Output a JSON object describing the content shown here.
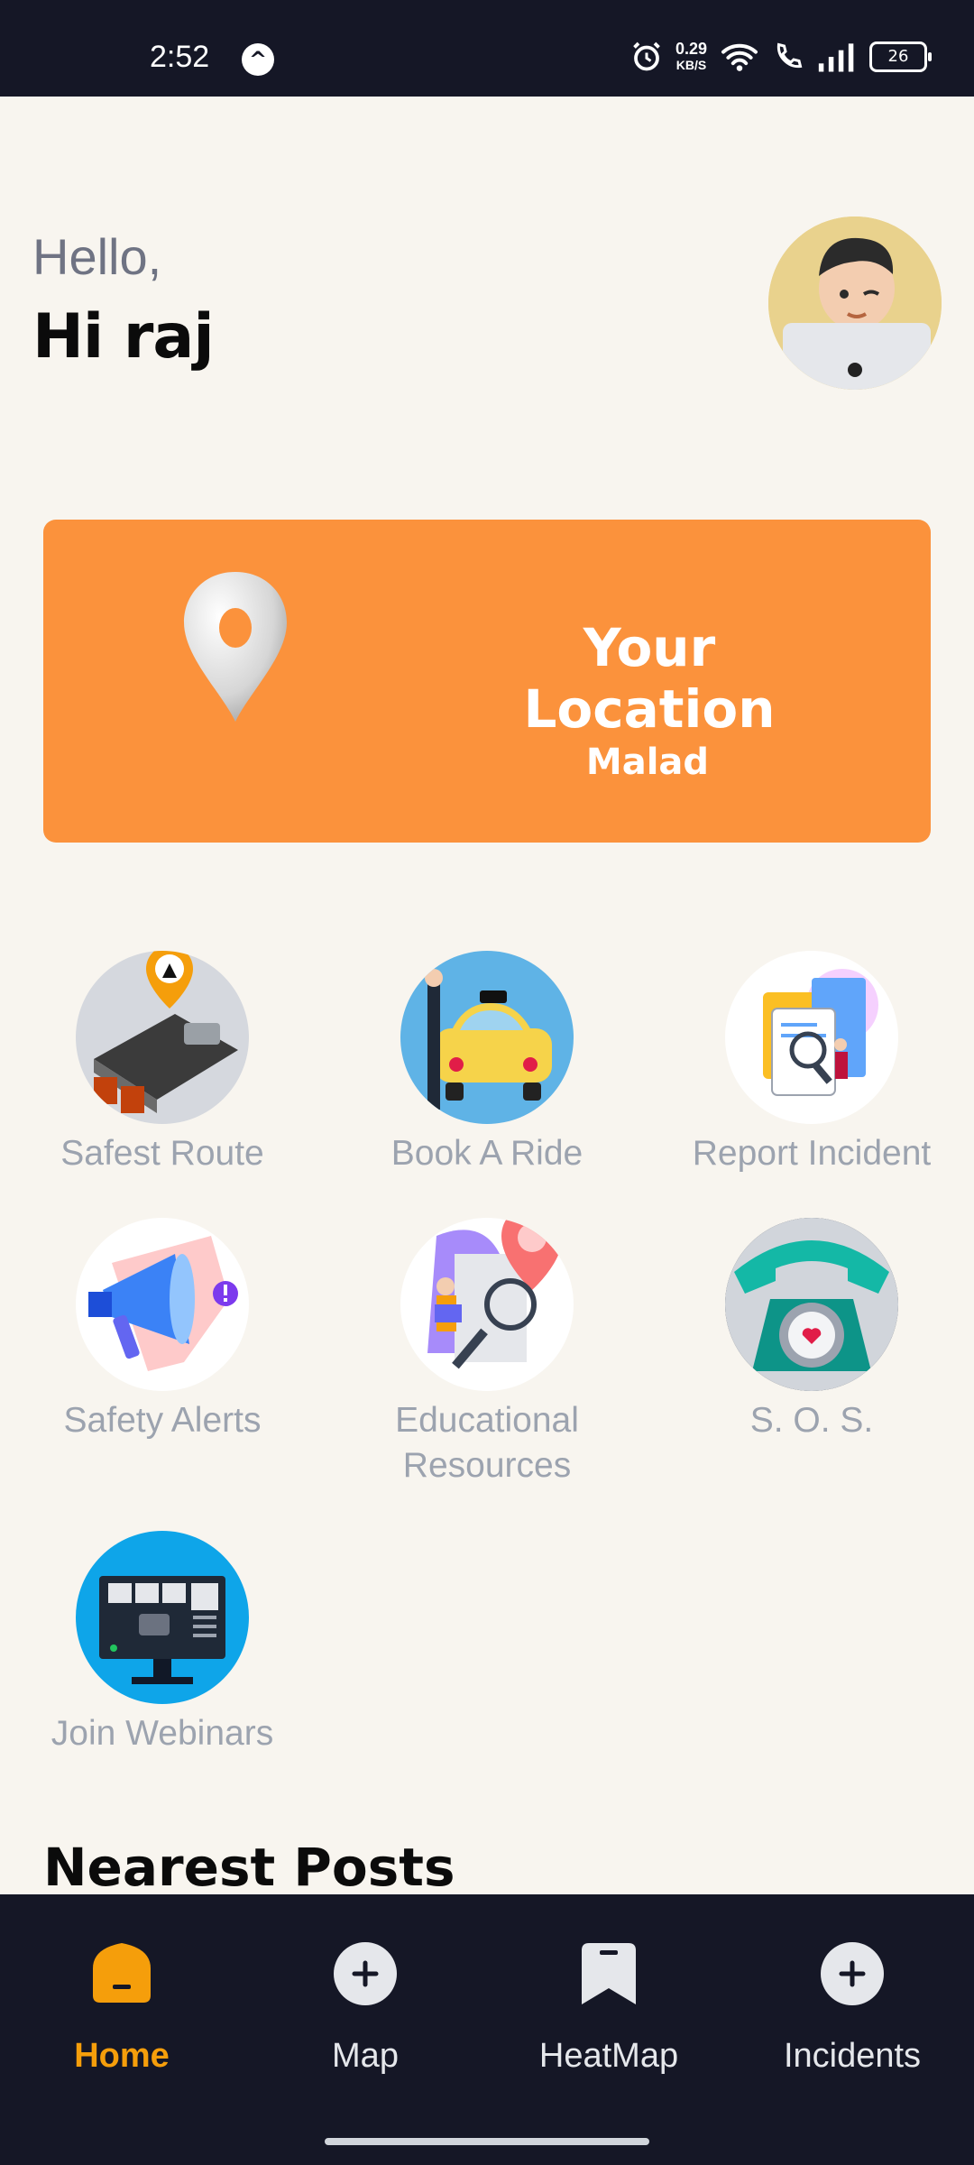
{
  "status_bar": {
    "time": "2:52",
    "net_speed_value": "0.29",
    "net_speed_unit": "KB/S",
    "battery": "26",
    "icons": [
      "app-logo-icon",
      "alarm-icon",
      "wifi-icon",
      "wifi-calling-icon",
      "signal-icon",
      "battery-icon"
    ]
  },
  "header": {
    "greeting": "Hello,",
    "user_greeting": "Hi raj",
    "avatar_icon": "memoji-avatar"
  },
  "location_card": {
    "title": "Your Location",
    "value": "Malad",
    "icon": "map-pin-icon",
    "color": "#fb923c"
  },
  "features": [
    {
      "label": "Safest Route",
      "icon": "road-construction-icon"
    },
    {
      "label": "Book A Ride",
      "icon": "taxi-icon"
    },
    {
      "label": "Report Incident",
      "icon": "report-document-icon"
    },
    {
      "label": "Safety Alerts",
      "icon": "megaphone-icon"
    },
    {
      "label": "Educational\nResources",
      "icon": "education-pin-icon"
    },
    {
      "label": "S. O. S.",
      "icon": "telephone-icon"
    },
    {
      "label": "Join Webinars",
      "icon": "webinar-monitor-icon"
    }
  ],
  "sections": {
    "nearest_posts": "Nearest Posts"
  },
  "bottom_nav": {
    "active": "Home",
    "items": [
      {
        "label": "Home",
        "icon": "home-icon"
      },
      {
        "label": "Map",
        "icon": "plus-circle-icon"
      },
      {
        "label": "HeatMap",
        "icon": "bookmark-icon"
      },
      {
        "label": "Incidents",
        "icon": "plus-circle-icon"
      }
    ]
  },
  "colors": {
    "accent": "#fb923c",
    "active_nav": "#f59e0b",
    "background": "#f8f5ef",
    "nav_background": "#151726"
  }
}
